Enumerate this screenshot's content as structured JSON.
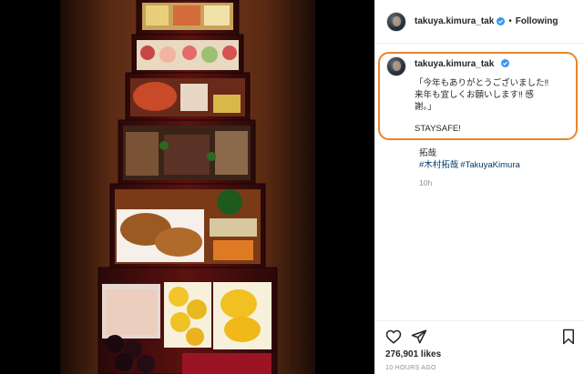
{
  "post": {
    "username": "takuya.kimura_tak",
    "follow_label": "Following",
    "header_separator": "•",
    "caption": {
      "username": "takuya.kimura_tak",
      "text": "「今年もありがとうございました‼\n来年も宜しくお願いします‼ 感\n謝。」",
      "staysafe": "STAYSAFE!"
    },
    "comment_name": "拓哉",
    "hashtags": [
      "#木村拓哉",
      "#TakuyaKimura"
    ],
    "time_ago": "10h",
    "likes": "276,901 likes",
    "posted": "10 HOURS AGO"
  },
  "icons": {
    "verified": "verified-badge-icon",
    "like": "heart-icon",
    "share": "paper-plane-icon",
    "save": "bookmark-icon",
    "more": "more-options-icon"
  },
  "colors": {
    "highlight": "#e8842c",
    "hashtag": "#00376b",
    "verified": "#3897f0"
  }
}
